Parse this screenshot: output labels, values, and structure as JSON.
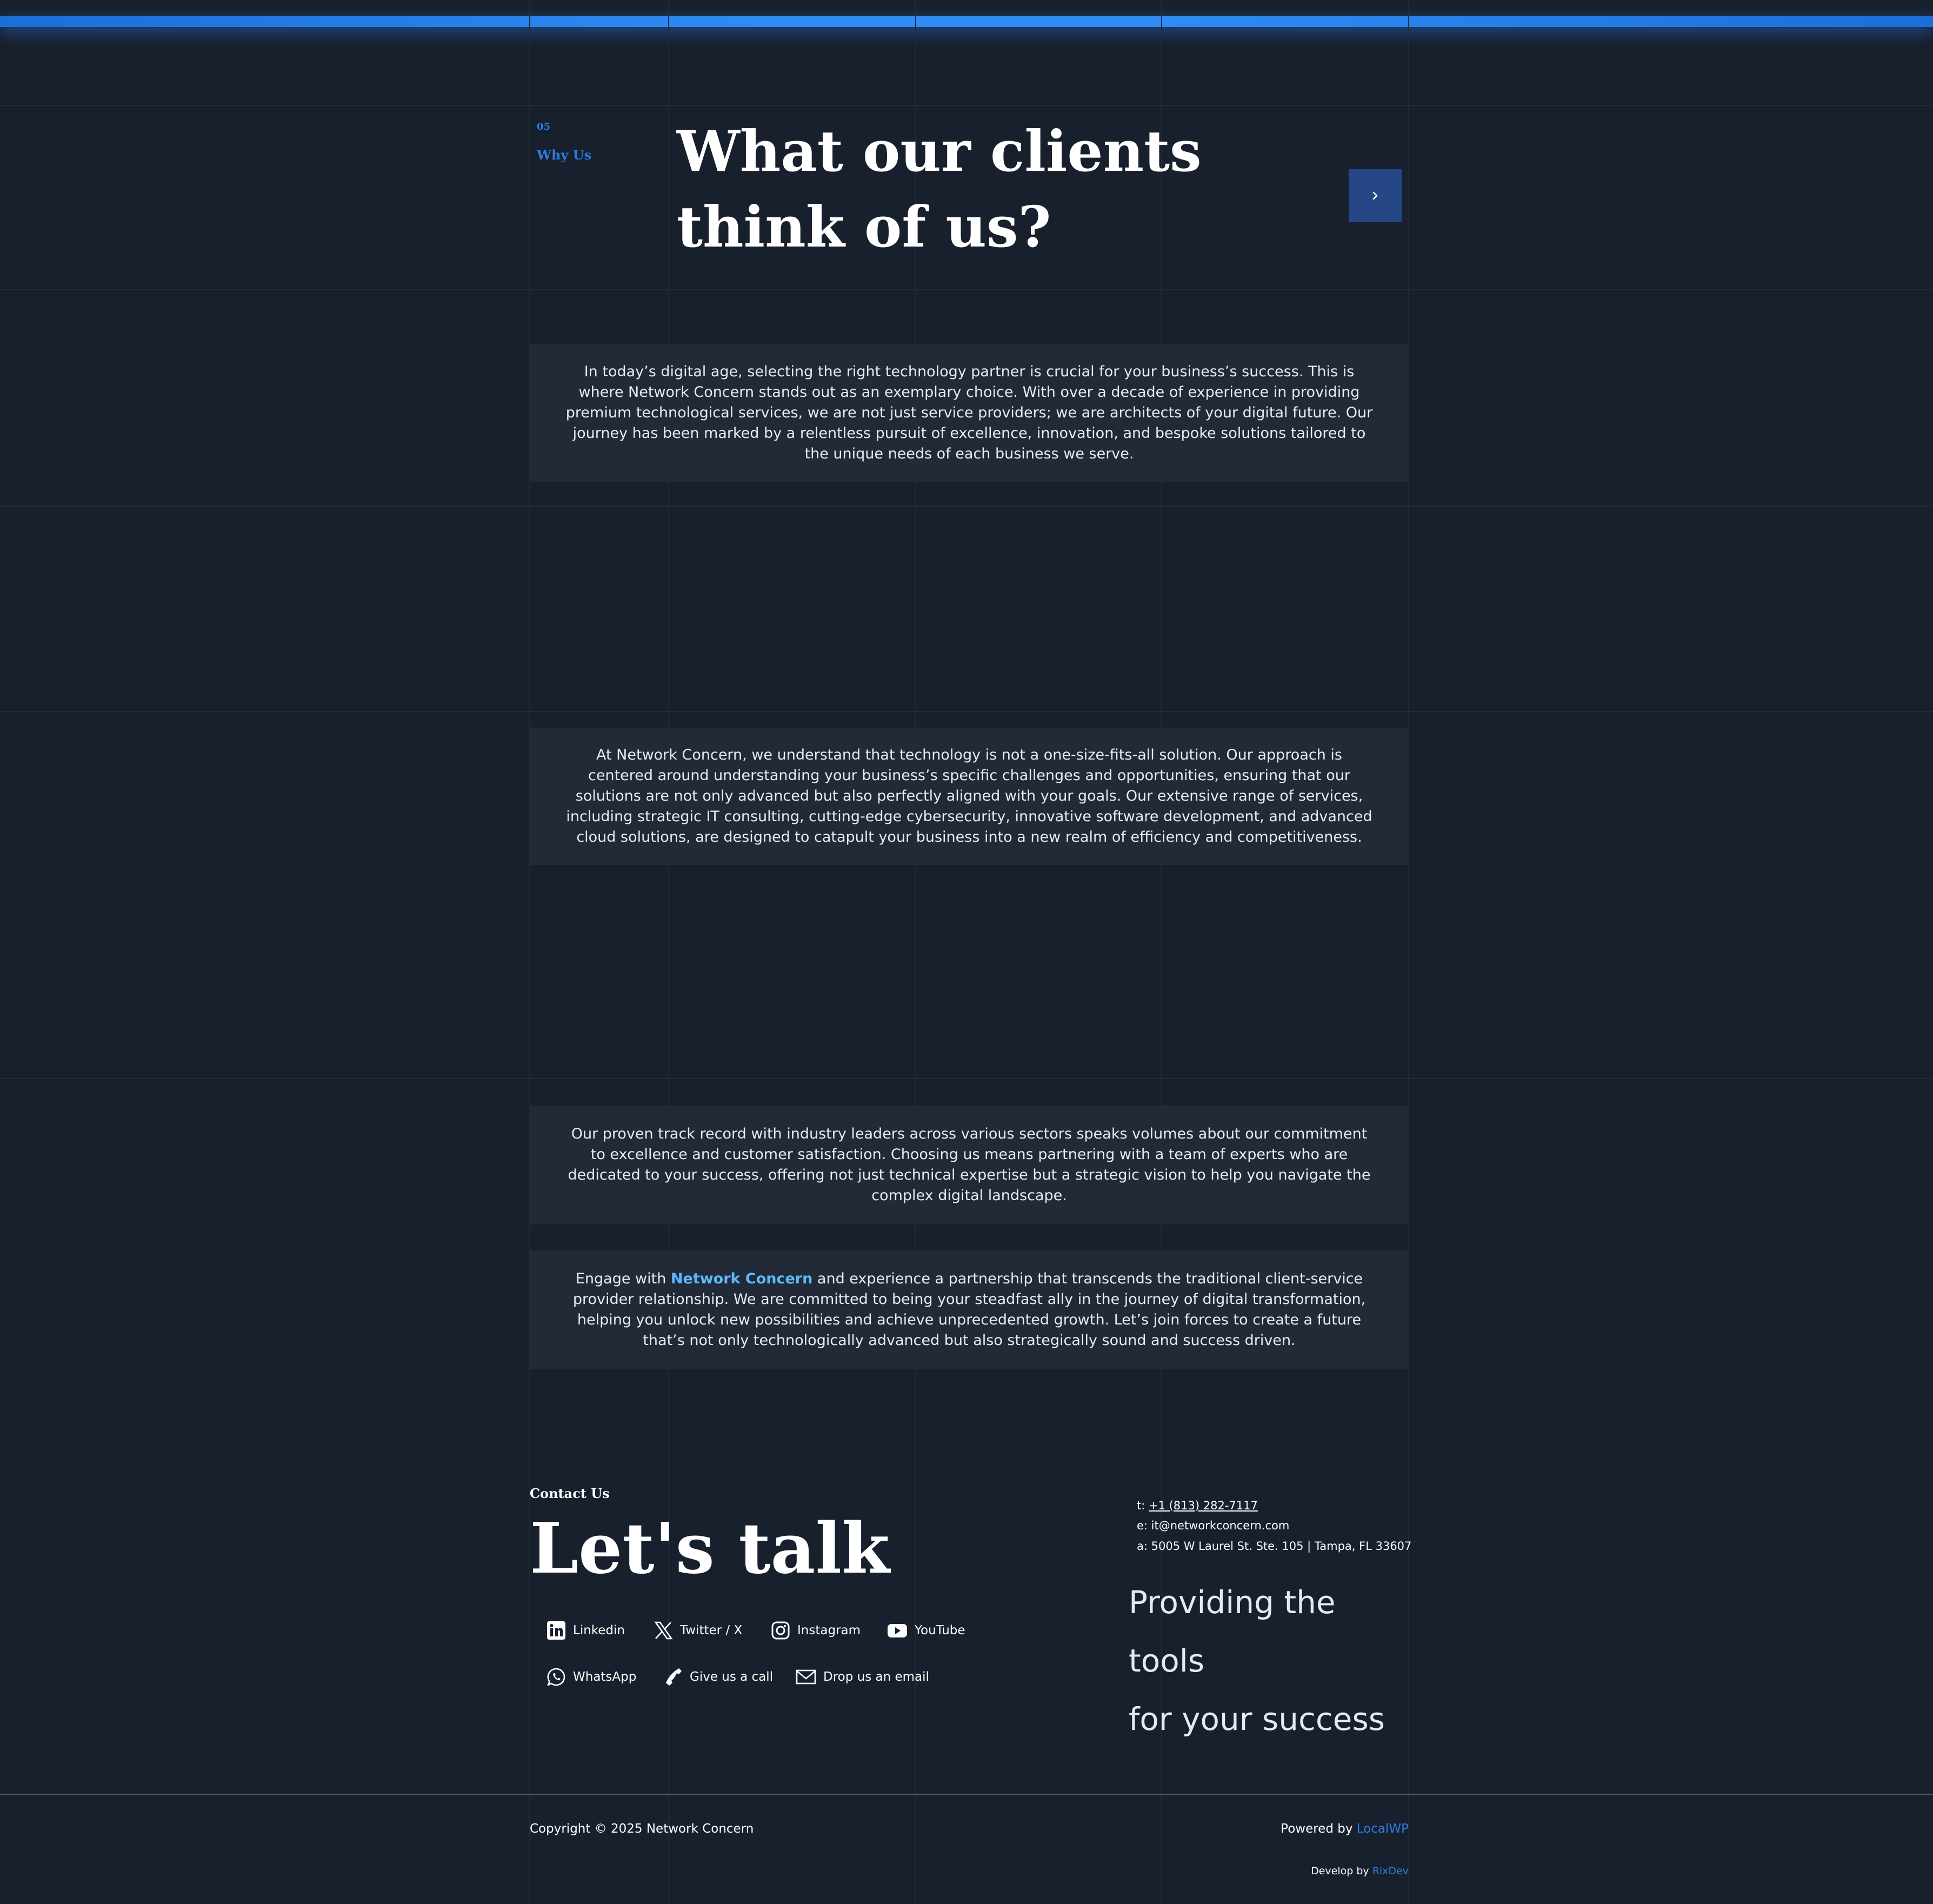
{
  "section": {
    "number": "05",
    "label": "Why Us"
  },
  "headline": {
    "line1": "What our clients",
    "line2": "think of us?"
  },
  "next_button": {
    "icon": "chevron-right-icon"
  },
  "cards": [
    {
      "text": "In today’s digital age, selecting the right technology partner is crucial for your business’s success. This is where Network Concern stands out as an exemplary choice. With over a decade of experience in providing premium technological services, we are not just service providers; we are architects of your digital future. Our journey has been marked by a relentless pursuit of excellence, innovation, and bespoke solutions tailored to the unique needs of each business we serve."
    },
    {
      "text": "At Network Concern, we understand that technology is not a one-size-fits-all solution. Our approach is centered around understanding your business’s specific challenges and opportunities, ensuring that our solutions are not only advanced but also perfectly aligned with your goals. Our extensive range of services, including strategic IT consulting, cutting-edge cybersecurity, innovative software development, and advanced cloud solutions, are designed to catapult your business into a new realm of efficiency and competitiveness."
    },
    {
      "text": "Our proven track record with industry leaders across various sectors speaks volumes about our commitment to excellence and customer satisfaction. Choosing us means partnering with a team of experts who are dedicated to your success, offering not just technical expertise but a strategic vision to help you navigate the complex digital landscape."
    },
    {
      "prefix": "Engage with ",
      "highlight": "Network Concern",
      "suffix": " and experience a partnership that transcends the traditional client-service provider relationship. We are committed to being your steadfast ally in the journey of digital transformation, helping you unlock new possibilities and achieve unprecedented growth. Let’s join forces to create a future that’s not only technologically advanced but also strategically sound and success driven."
    }
  ],
  "contact": {
    "label": "Contact Us",
    "title": "Let's talk",
    "socials": [
      {
        "label": "Linkedin",
        "icon": "linkedin-icon"
      },
      {
        "label": "Twitter / X",
        "icon": "x-icon"
      },
      {
        "label": "Instagram",
        "icon": "instagram-icon"
      },
      {
        "label": "YouTube",
        "icon": "youtube-icon"
      },
      {
        "label": "WhatsApp",
        "icon": "whatsapp-icon"
      },
      {
        "label": "Give us a call",
        "icon": "phone-icon"
      },
      {
        "label": "Drop us an email",
        "icon": "mail-icon"
      }
    ],
    "phone_prefix": "t: ",
    "phone": "+1 (813) 282-7117",
    "email": "e: it@networkconcern.com",
    "address": "a: 5005 W Laurel St. Ste. 105 | Tampa, FL 33607",
    "tagline_line1": "Providing the tools",
    "tagline_line2": "for your success"
  },
  "footer": {
    "copyright": "Copyright © 2025 Network Concern",
    "powered_prefix": "Powered by ",
    "powered_link": "LocalWP",
    "develop_prefix": "Develop by ",
    "develop_link": "RixDev"
  },
  "colors": {
    "background": "#19202d",
    "accent": "#2a7de0",
    "card": "#212a36",
    "highlight": "#5cb9ff",
    "button": "#254785"
  }
}
